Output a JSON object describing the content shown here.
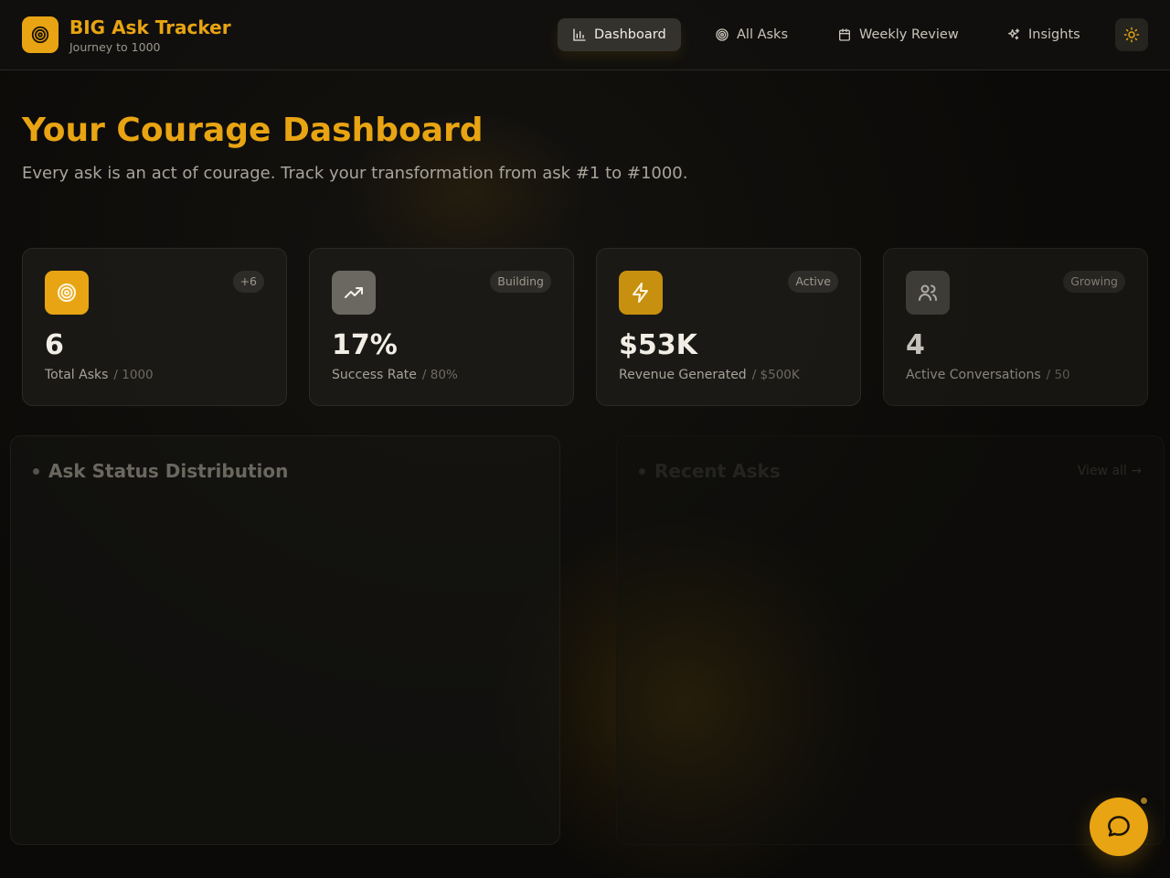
{
  "app": {
    "title": "BIG Ask Tracker",
    "subtitle": "Journey to 1000",
    "accent_color": "#e8a412"
  },
  "nav": {
    "items": [
      {
        "label": "Dashboard",
        "icon": "bar-chart-icon",
        "active": true
      },
      {
        "label": "All Asks",
        "icon": "target-icon",
        "active": false
      },
      {
        "label": "Weekly Review",
        "icon": "calendar-icon",
        "active": false
      },
      {
        "label": "Insights",
        "icon": "sparkles-icon",
        "active": false
      }
    ],
    "theme_toggle_icon": "sun-icon"
  },
  "hero": {
    "title": "Your Courage Dashboard",
    "subtitle": "Every ask is an act of courage. Track your transformation from ask #1 to #1000."
  },
  "stats": [
    {
      "value": "6",
      "label": "Total Asks",
      "target": "/ 1000",
      "badge": "+6",
      "icon": "target-icon",
      "icon_bg": "#e8a412"
    },
    {
      "value": "17%",
      "label": "Success Rate",
      "target": "/ 80%",
      "badge": "Building",
      "icon": "trending-up-icon",
      "icon_bg": "#6b6862"
    },
    {
      "value": "$53K",
      "label": "Revenue Generated",
      "target": "/ $500K",
      "badge": "Active",
      "icon": "lightning-icon",
      "icon_bg": "#c8900f"
    },
    {
      "value": "4",
      "label": "Active Conversations",
      "target": "/ 50",
      "badge": "Growing",
      "icon": "users-icon",
      "icon_bg": "#4a4843"
    }
  ],
  "panels": {
    "status_title": "Ask Status Distribution",
    "recent_title": "Recent Asks",
    "view_all": "View all →"
  },
  "chat": {
    "icon": "chat-bubble-icon"
  }
}
